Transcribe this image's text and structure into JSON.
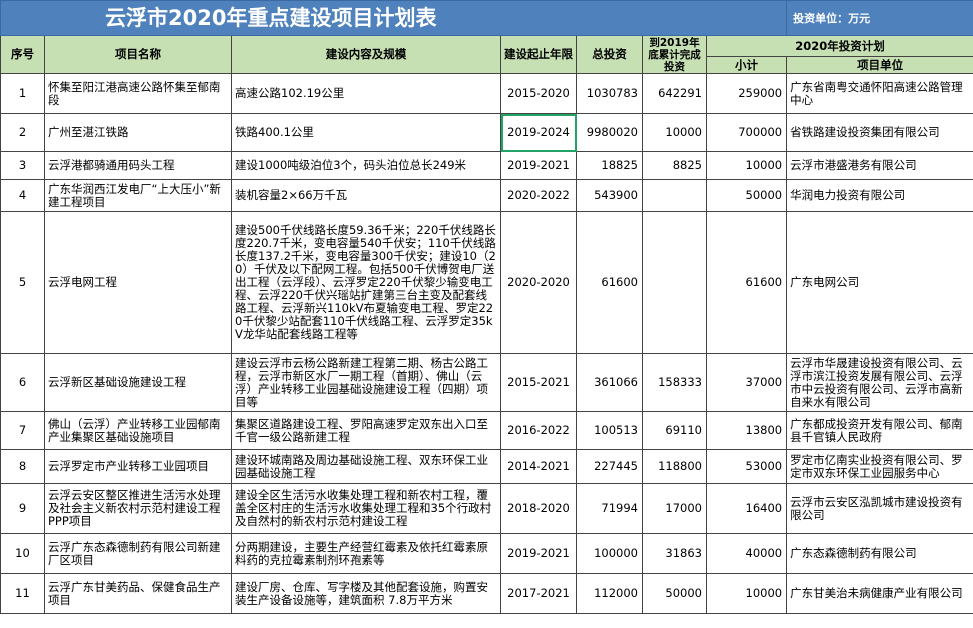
{
  "title": "云浮市2020年重点建设项目计划表",
  "unit": "投资单位：万元",
  "headers": {
    "no": "序号",
    "name": "项目名称",
    "content": "建设内容及规模",
    "period": "建设起止年限",
    "total": "总投资",
    "cumulative": "到2019年底累计完成投资",
    "plan2020": "2020年投资计划",
    "subtotal": "小计",
    "owner": "项目单位"
  },
  "rows": [
    {
      "no": "1",
      "name": "怀集至阳江港高速公路怀集至郁南段",
      "content": "高速公路102.19公里",
      "period": "2015-2020",
      "total": "1030783",
      "cumulative": "642291",
      "subtotal": "259000",
      "owner": "广东省南粤交通怀阳高速公路管理中心"
    },
    {
      "no": "2",
      "name": "广州至湛江铁路",
      "content": "铁路400.1公里",
      "period": "2019-2024",
      "total": "9980020",
      "cumulative": "10000",
      "subtotal": "700000",
      "owner": "省铁路建设投资集团有限公司"
    },
    {
      "no": "3",
      "name": "云浮港都骑通用码头工程",
      "content": "建设1000吨级泊位3个，码头泊位总长249米",
      "period": "2019-2021",
      "total": "18825",
      "cumulative": "8825",
      "subtotal": "10000",
      "owner": "云浮市港盛港务有限公司"
    },
    {
      "no": "4",
      "name": "广东华润西江发电厂“上大压小”新建工程项目",
      "content": "装机容量2×66万千瓦",
      "period": "2020-2022",
      "total": "543900",
      "cumulative": "",
      "subtotal": "50000",
      "owner": "华润电力投资有限公司"
    },
    {
      "no": "5",
      "name": "云浮电网工程",
      "content": "建设500千伏线路长度59.36千米；220千伏线路长度220.7千米，变电容量540千伏安；110千伏线路长度137.2千米，变电容量300千伏安；建设10（20）千伏及以下配网工程。包括500千伏博贺电厂送出工程（云浮段）、云浮罗定220千伏黎少输变电工程、云浮220千伏兴瑶站扩建第三台主变及配套线路工程、云浮新兴110kV布夏输变电工程、罗定220千伏黎少站配套110千伏线路工程、云浮罗定35kV龙华站配套线路工程等",
      "period": "2020-2020",
      "total": "61600",
      "cumulative": "",
      "subtotal": "61600",
      "owner": "广东电网公司"
    },
    {
      "no": "6",
      "name": "云浮新区基础设施建设工程",
      "content": "建设云浮市云杨公路新建工程第二期、杨古公路工程，云浮市新区水厂一期工程（首期）、佛山（云浮）产业转移工业园基础设施建设工程（四期）项目等",
      "period": "2015-2021",
      "total": "361066",
      "cumulative": "158333",
      "subtotal": "37000",
      "owner": "云浮市华晟建设投资有限公司、云浮市滨江投资发展有限公司、云浮市中云投资有限公司、云浮市高新自来水有限公司"
    },
    {
      "no": "7",
      "name": "佛山（云浮）产业转移工业园郁南产业集聚区基础设施项目",
      "content": "集聚区道路建设工程、罗阳高速罗定双东出入口至千官一级公路新建工程",
      "period": "2016-2022",
      "total": "100513",
      "cumulative": "69110",
      "subtotal": "13800",
      "owner": "广东都成投资开发有限公司、郁南县千官镇人民政府"
    },
    {
      "no": "8",
      "name": "云浮罗定市产业转移工业园项目",
      "content": "建设环城南路及周边基础设施工程、双东环保工业园基础设施工程",
      "period": "2014-2021",
      "total": "227445",
      "cumulative": "118800",
      "subtotal": "53000",
      "owner": "罗定市亿南实业投资有限公司、罗定市双东环保工业园服务中心"
    },
    {
      "no": "9",
      "name": "云浮云安区整区推进生活污水处理及社会主义新农村示范村建设工程 PPP项目",
      "content": "建设全区生活污水收集处理工程和新农村工程，覆盖全区村庄的生活污水收集处理工程和35个行政村及自然村的新农村示范村建设工程",
      "period": "2018-2020",
      "total": "71994",
      "cumulative": "17000",
      "subtotal": "16400",
      "owner": "云浮市云安区泓凯城市建设投资有限公司"
    },
    {
      "no": "10",
      "name": "云浮广东态森德制药有限公司新建厂区项目",
      "content": "分两期建设，主要生产经营红霉素及依托红霉素原料药的克拉霉素制剂环孢素等",
      "period": "2019-2021",
      "total": "100000",
      "cumulative": "31863",
      "subtotal": "40000",
      "owner": "广东态森德制药有限公司"
    },
    {
      "no": "11",
      "name": "云浮广东甘美药品、保健食品生产项目",
      "content": "建设厂房、仓库、写字楼及其他配套设施，购置安装生产设备设施等，建筑面积 7.8万平方米",
      "period": "2017-2021",
      "total": "112000",
      "cumulative": "50000",
      "subtotal": "10000",
      "owner": "广东甘美治未病健康产业有限公司"
    }
  ]
}
